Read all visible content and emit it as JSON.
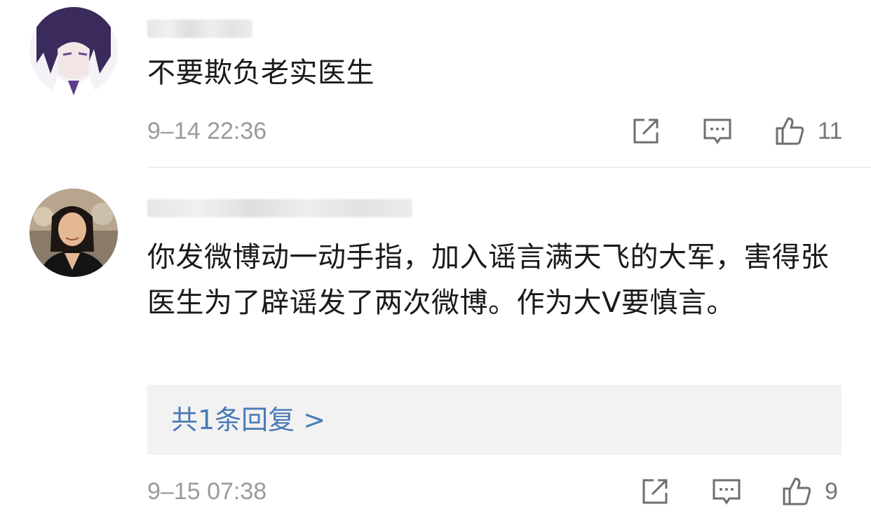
{
  "comments": [
    {
      "text": "不要欺负老实医生",
      "time": "9–14 22:36",
      "likes": "11",
      "icons": {
        "share": "share-icon",
        "comment": "comment-icon",
        "like": "thumbs-up-icon"
      }
    },
    {
      "text": "你发微博动一动手指，加入谣言满天飞的大军，害得张医生为了辟谣发了两次微博。作为大V要慎言。",
      "reply_link": "共1条回复 >",
      "time": "9–15 07:38",
      "likes": "9",
      "icons": {
        "share": "share-icon",
        "comment": "comment-icon",
        "like": "thumbs-up-icon"
      }
    }
  ],
  "colors": {
    "link": "#4a7ab8",
    "meta": "#9b9b9b",
    "divider": "#e2e2e2",
    "reply_bg": "#f2f2f2"
  }
}
